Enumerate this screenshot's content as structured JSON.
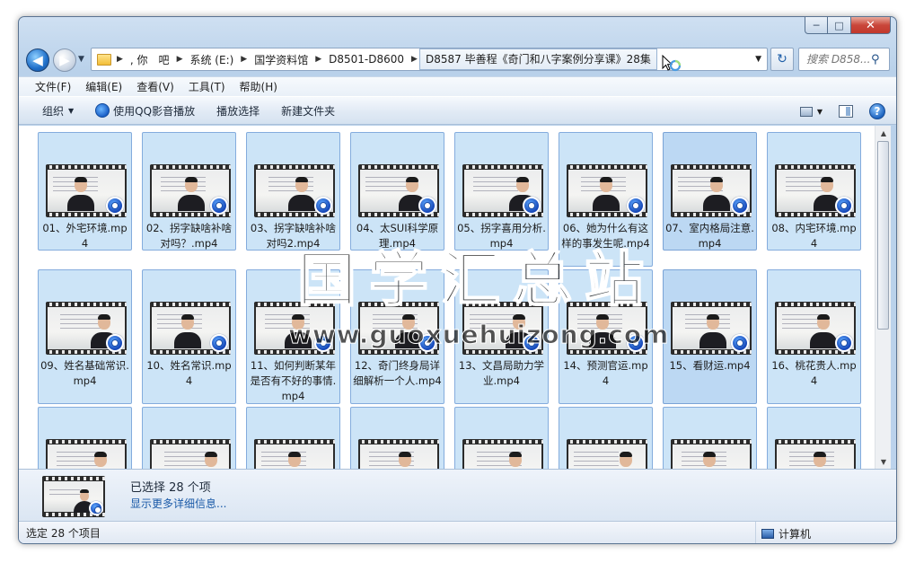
{
  "window": {
    "caption": {
      "minimize": "─",
      "maximize": "□",
      "close": "✕"
    }
  },
  "nav": {
    "back_glyph": "◀",
    "forward_glyph": "▶",
    "history_glyph": "▼",
    "breadcrumbs": [
      ", 你　吧",
      "系统 (E:)",
      "国学资料馆",
      "D8501-D8600",
      "D8587 毕善程《奇门和八字案例分享课》28集"
    ],
    "separator": "▶",
    "dropdown": "▼",
    "refresh": "↻",
    "search_placeholder": "搜索 D858...",
    "search_icon": "⚲"
  },
  "menu": [
    "文件(F)",
    "编辑(E)",
    "查看(V)",
    "工具(T)",
    "帮助(H)"
  ],
  "commands": {
    "organize": "组织",
    "play_qq": "使用QQ影音播放",
    "play_selected": "播放选择",
    "new_folder": "新建文件夹",
    "dropdown": "▼",
    "help": "?"
  },
  "files": [
    {
      "label": "01、外宅环境.mp4"
    },
    {
      "label": "02、拐字缺啥补啥对吗？.mp4"
    },
    {
      "label": "03、拐字缺啥补啥对吗2.mp4"
    },
    {
      "label": "04、太SUI科学原理.mp4"
    },
    {
      "label": "05、拐字喜用分析.mp4"
    },
    {
      "label": "06、她为什么有这样的事发生呢.mp4"
    },
    {
      "label": "07、室内格局注意.mp4"
    },
    {
      "label": "08、内宅环境.mp4"
    },
    {
      "label": "09、姓名基础常识.mp4"
    },
    {
      "label": "10、姓名常识.mp4"
    },
    {
      "label": "11、如何判断某年是否有不好的事情.mp4"
    },
    {
      "label": "12、奇门终身局详细解析一个人.mp4"
    },
    {
      "label": "13、文昌局助力学业.mp4"
    },
    {
      "label": "14、预测官运.mp4"
    },
    {
      "label": "15、看财运.mp4"
    },
    {
      "label": "16、桃花贵人.mp4"
    },
    {
      "label": ""
    },
    {
      "label": ""
    },
    {
      "label": ""
    },
    {
      "label": ""
    },
    {
      "label": ""
    },
    {
      "label": ""
    },
    {
      "label": ""
    },
    {
      "label": ""
    }
  ],
  "watermark": {
    "title": "国学汇总站",
    "url": "www.guoxuehuizong.com"
  },
  "scrollbar": {
    "up": "▲",
    "down": "▼"
  },
  "details": {
    "selected": "已选择 28 个项",
    "more_info": "显示更多详细信息..."
  },
  "status": {
    "selected_count": "选定 28 个项目",
    "location": "计算机"
  },
  "colors": {
    "tile_bg": "#cce4f7",
    "tile_border": "#84acdd",
    "accent_link": "#1a5aa8",
    "close_button": "#c9463a"
  }
}
